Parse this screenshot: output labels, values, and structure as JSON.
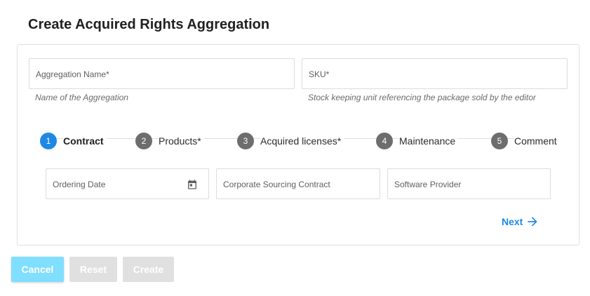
{
  "page": {
    "title": "Create Acquired Rights Aggregation"
  },
  "form": {
    "aggregation_name": {
      "placeholder": "Aggregation Name*",
      "hint": "Name of the Aggregation"
    },
    "sku": {
      "placeholder": "SKU*",
      "hint": "Stock keeping unit referencing the package sold by the editor"
    }
  },
  "stepper": {
    "steps": [
      {
        "number": "1",
        "label": "Contract",
        "active": true
      },
      {
        "number": "2",
        "label": "Products*",
        "active": false
      },
      {
        "number": "3",
        "label": "Acquired licenses*",
        "active": false
      },
      {
        "number": "4",
        "label": "Maintenance",
        "active": false
      },
      {
        "number": "5",
        "label": "Comment",
        "active": false
      }
    ],
    "contract_fields": {
      "ordering_date": "Ordering Date",
      "corporate_sourcing_contract": "Corporate Sourcing Contract",
      "software_provider": "Software Provider"
    },
    "next_label": "Next"
  },
  "actions": {
    "cancel_label": "Cancel",
    "reset_label": "Reset",
    "create_label": "Create"
  },
  "colors": {
    "accent": "#1e88e5",
    "cancel_bg": "#80deff",
    "disabled_bg": "#e0e0e0",
    "inactive_step": "#6d6d6d"
  },
  "icons": {
    "date_picker": "calendar-icon",
    "next": "arrow-right-icon"
  }
}
